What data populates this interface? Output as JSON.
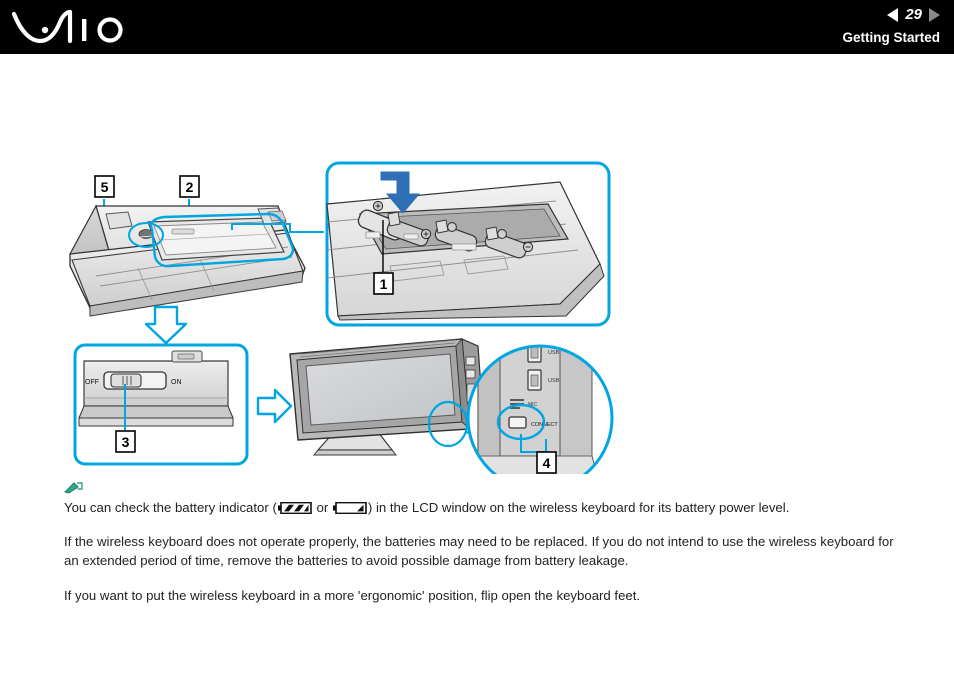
{
  "header": {
    "logo_text": "VAIO",
    "logo_icon": "vaio-logo",
    "prev_icon": "left-arrow-icon",
    "next_icon": "right-arrow-icon",
    "page_number": "29",
    "section_title": "Getting Started"
  },
  "figure": {
    "name": "wireless-keyboard-battery-setup-diagram",
    "callouts": [
      {
        "id": "1",
        "label": "1"
      },
      {
        "id": "2",
        "label": "2"
      },
      {
        "id": "3",
        "label": "3"
      },
      {
        "id": "4",
        "label": "4"
      },
      {
        "id": "5",
        "label": "5"
      }
    ],
    "switch_labels": {
      "off": "OFF",
      "on": "ON"
    },
    "connect_button_label": "CONNECT",
    "arrows": [
      {
        "name": "down-arrow-icon",
        "direction": "down"
      },
      {
        "name": "right-arrow-icon",
        "direction": "right"
      },
      {
        "name": "battery-insert-arrow-icon",
        "direction": "down-right"
      }
    ],
    "accent_color": "#00a6e2"
  },
  "content": {
    "note_icon": "note-pencil-icon",
    "note_text_before": "You can check the battery indicator (",
    "battery_full_icon": "battery-full-icon",
    "note_text_or": " or ",
    "battery_low_icon": "battery-low-icon",
    "note_text_after": ") in the LCD window on the wireless keyboard for its battery power level.",
    "paragraph_2": "If the wireless keyboard does not operate properly, the batteries may need to be replaced. If you do not intend to use the wireless keyboard for an extended period of time, remove the batteries to avoid possible damage from battery leakage.",
    "paragraph_3": "If you want to put the wireless keyboard in a more 'ergonomic' position, flip open the keyboard feet."
  }
}
